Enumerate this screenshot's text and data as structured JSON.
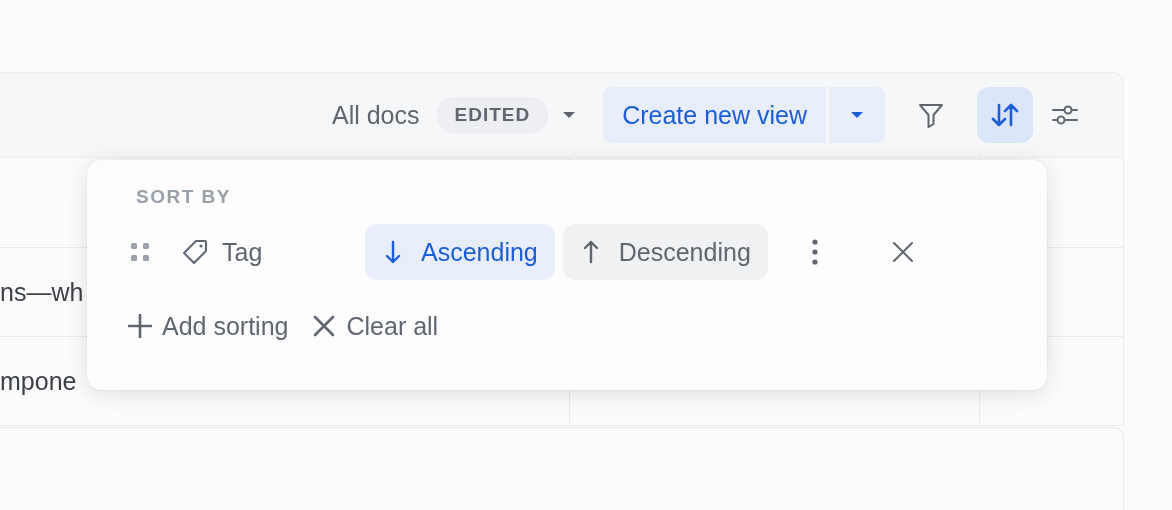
{
  "toolbar": {
    "view_name": "All docs",
    "badge": "EDITED",
    "create_button": "Create new view",
    "sort_button": {
      "selected": true
    }
  },
  "table": {
    "rows": [
      {
        "cells": [
          "ns—wh"
        ]
      },
      {
        "cells": [
          "mpone"
        ]
      }
    ]
  },
  "sort_popup": {
    "heading": "SORT BY",
    "rules": [
      {
        "field": "Tag",
        "options": [
          {
            "label": "Ascending",
            "kind": "asc",
            "selected": true
          },
          {
            "label": "Descending",
            "kind": "desc",
            "selected": false
          }
        ]
      }
    ],
    "actions": [
      {
        "label": "Add sorting",
        "kind": "add"
      },
      {
        "label": "Clear all",
        "kind": "clear"
      }
    ]
  }
}
